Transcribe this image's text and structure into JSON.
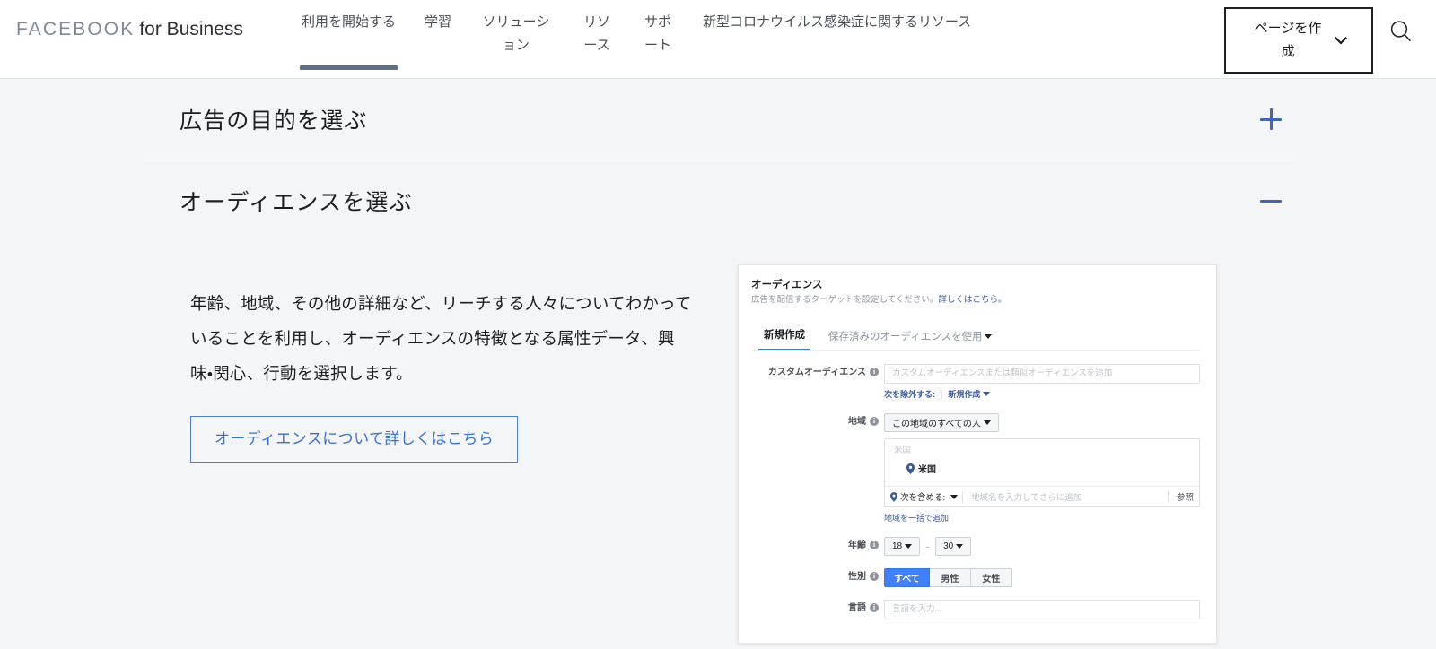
{
  "header": {
    "logo_mark": "FACEBOOK",
    "logo_sub": "for Business",
    "nav": [
      {
        "label": "利用を開始する",
        "active": true
      },
      {
        "label": "学習",
        "active": false
      },
      {
        "label": "ソリューション",
        "active": false
      },
      {
        "label": "リソース",
        "active": false
      },
      {
        "label": "サポート",
        "active": false
      },
      {
        "label": "新型コロナウイルス感染症に関するリソース",
        "active": false
      }
    ],
    "create_page_label": "ページを作成",
    "search_icon": "search-icon",
    "chevron_icon": "chevron-down-icon"
  },
  "accordions": [
    {
      "title": "広告の目的を選ぶ",
      "state": "collapsed",
      "toggle_icon": "plus-icon"
    },
    {
      "title": "オーディエンスを選ぶ",
      "state": "expanded",
      "toggle_icon": "minus-icon"
    }
  ],
  "section": {
    "body_text": "年齢、地域、その他の詳細など、リーチする人々についてわかっていることを利用し、オーディエンスの特徴となる属性データ、興味・関心、行動を選択します。",
    "learn_more_label": "オーディエンスについて詳しくはこちら"
  },
  "mockup": {
    "title": "オーディエンス",
    "subtitle_text": "広告を配信するターゲットを設定してください。",
    "subtitle_link": "詳しくはこちら。",
    "tabs": [
      {
        "label": "新規作成",
        "active": true
      },
      {
        "label": "保存済みのオーディエンスを使用",
        "active": false,
        "caret": true
      }
    ],
    "fields": {
      "custom_audience": {
        "label": "カスタムオーディエンス",
        "placeholder": "カスタムオーディエンスまたは類似オーディエンスを追加",
        "exclude_label": "次を除外する:",
        "exclude_action": "新規作成"
      },
      "region": {
        "label": "地域",
        "select_value": "この地域のすべての人",
        "map_label": "米国",
        "pin_label": "米国",
        "include_label": "次を含める:",
        "typeahead_placeholder": "地域名を入力してさらに追加",
        "browse_label": "参照",
        "bulk_add_label": "地域を一括で追加"
      },
      "age": {
        "label": "年齢",
        "min": "18",
        "max": "30",
        "separator": "-"
      },
      "gender": {
        "label": "性別",
        "options": [
          {
            "label": "すべて",
            "active": true
          },
          {
            "label": "男性",
            "active": false
          },
          {
            "label": "女性",
            "active": false
          }
        ]
      },
      "language": {
        "label": "言語",
        "placeholder": "言語を入力..."
      }
    }
  },
  "colors": {
    "page_background": "#f4f5f7",
    "accent_blue": "#4267b2",
    "fb_blue": "#4080ff",
    "link_blue": "#3b5998",
    "active_tab_underline": "#5d6f82"
  }
}
